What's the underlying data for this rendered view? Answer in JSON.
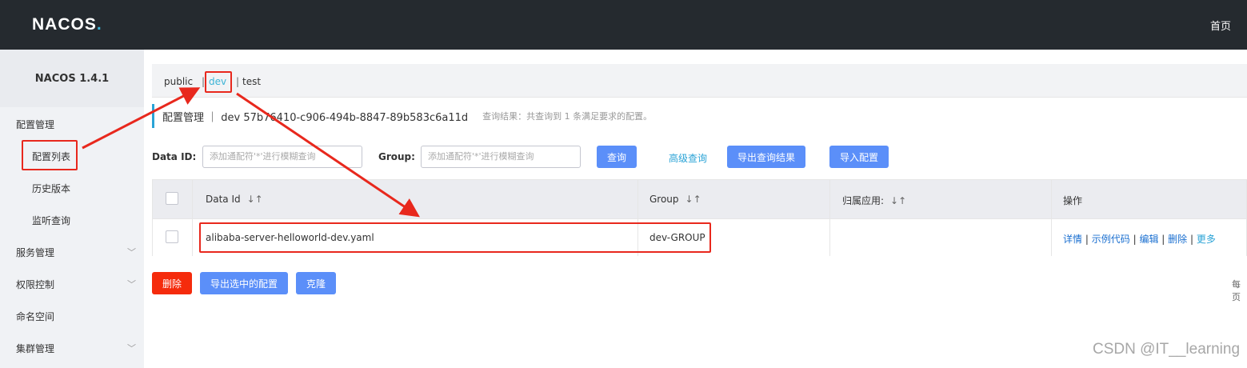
{
  "header": {
    "logo": "NACOS",
    "logo_dot": ".",
    "home": "首页"
  },
  "sidebar": {
    "version": "NACOS 1.4.1",
    "items": [
      {
        "label": "配置管理"
      },
      {
        "label": "配置列表"
      },
      {
        "label": "历史版本"
      },
      {
        "label": "监听查询"
      },
      {
        "label": "服务管理"
      },
      {
        "label": "权限控制"
      },
      {
        "label": "命名空间"
      },
      {
        "label": "集群管理"
      }
    ]
  },
  "namespaces": {
    "public": "public",
    "dev": "dev",
    "test": "test",
    "sep": "|"
  },
  "title": {
    "text": "配置管理 ｜ dev  57b76410-c906-494b-8847-89b583c6a11d",
    "result": "查询结果：共查询到 1 条满足要求的配置。"
  },
  "search": {
    "data_id_label": "Data ID:",
    "data_id_placeholder": "添加通配符'*'进行模糊查询",
    "group_label": "Group:",
    "group_placeholder": "添加通配符'*'进行模糊查询",
    "query_btn": "查询",
    "advanced": "高级查询",
    "export_btn": "导出查询结果",
    "import_btn": "导入配置"
  },
  "table": {
    "headers": {
      "data_id": "Data Id",
      "group": "Group",
      "app": "归属应用:",
      "ops": "操作",
      "sort": "↓↑"
    },
    "rows": [
      {
        "data_id": "alibaba-server-helloworld-dev.yaml",
        "group": "dev-GROUP",
        "app": ""
      }
    ],
    "ops": {
      "detail": "详情",
      "sample": "示例代码",
      "edit": "编辑",
      "delete": "删除",
      "more": "更多",
      "sep": "|"
    }
  },
  "bottom": {
    "delete_btn": "删除",
    "export_selected_btn": "导出选中的配置",
    "clone_btn": "克隆",
    "paging": "每页"
  },
  "watermark": "CSDN @IT__learning",
  "colors": {
    "accent": "#5b8ff9",
    "danger": "#f52b0c",
    "link": "#2aa3d6",
    "annotation": "#e8281d"
  }
}
